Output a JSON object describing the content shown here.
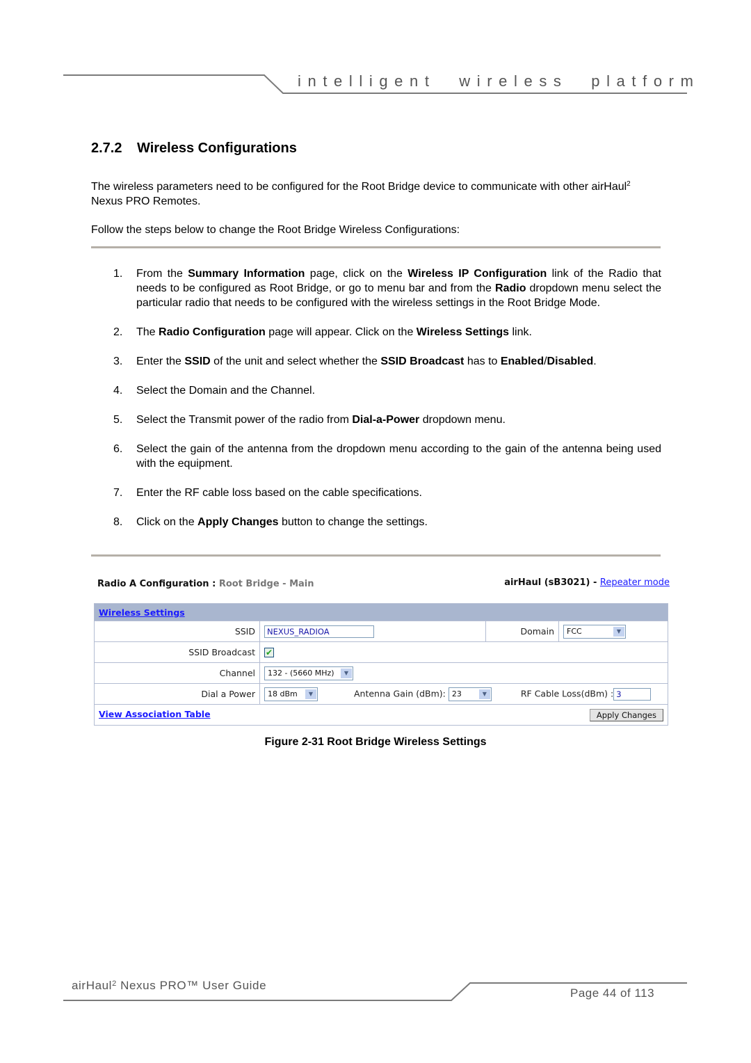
{
  "header": {
    "tagline": "intelligent wireless platform"
  },
  "section": {
    "number": "2.7.2",
    "title": "Wireless Configurations"
  },
  "intro": {
    "line_pre": "The wireless parameters need to be configured for the Root Bridge device to communicate with other airHaul",
    "superscript": "2",
    "line_post": " Nexus PRO Remotes.",
    "follow": "Follow the steps below to change the Root Bridge Wireless Configurations:"
  },
  "steps": [
    {
      "n": "1.",
      "parts": [
        [
          "From the ",
          false
        ],
        [
          "Summary Information",
          true
        ],
        [
          " page, click on the ",
          false
        ],
        [
          "Wireless IP Configuration",
          true
        ],
        [
          " link of the Radio that needs to be configured as Root Bridge, or go to menu bar and from the ",
          false
        ],
        [
          "Radio",
          true
        ],
        [
          " dropdown menu select the particular radio that needs to be configured with the wireless settings in the Root Bridge Mode.",
          false
        ]
      ]
    },
    {
      "n": "2.",
      "parts": [
        [
          "The ",
          false
        ],
        [
          "Radio Configuration",
          true
        ],
        [
          " page will appear. Click on the ",
          false
        ],
        [
          "Wireless Settings",
          true
        ],
        [
          " link.",
          false
        ]
      ]
    },
    {
      "n": "3.",
      "parts": [
        [
          "Enter the ",
          false
        ],
        [
          "SSID",
          true
        ],
        [
          " of the unit and select whether the ",
          false
        ],
        [
          "SSID Broadcast",
          true
        ],
        [
          " has to ",
          false
        ],
        [
          "Enabled",
          true
        ],
        [
          "/",
          false
        ],
        [
          "Disabled",
          true
        ],
        [
          ".",
          false
        ]
      ]
    },
    {
      "n": "4.",
      "parts": [
        [
          "Select the Domain and the Channel.",
          false
        ]
      ]
    },
    {
      "n": "5.",
      "parts": [
        [
          "Select the Transmit power of the radio from ",
          false
        ],
        [
          "Dial-a-Power",
          true
        ],
        [
          " dropdown menu.",
          false
        ]
      ]
    },
    {
      "n": "6.",
      "parts": [
        [
          "Select the gain of the antenna from the dropdown menu according to the gain of the antenna being used with the equipment.",
          false
        ]
      ]
    },
    {
      "n": "7.",
      "parts": [
        [
          "Enter the RF cable loss based on the cable specifications.",
          false
        ]
      ]
    },
    {
      "n": "8.",
      "parts": [
        [
          "Click on the ",
          false
        ],
        [
          "Apply Changes",
          true
        ],
        [
          " button to change the settings.",
          false
        ]
      ]
    }
  ],
  "figure": {
    "title": "Radio A Configuration : ",
    "subtitle": "Root Bridge - Main",
    "device": "airHaul (sB3021) - ",
    "mode_link": "Repeater mode",
    "section_link": "Wireless Settings",
    "ssid_label": "SSID",
    "ssid_value": "NEXUS_RADIOA",
    "domain_label": "Domain",
    "domain_value": "FCC",
    "ssid_broadcast_label": "SSID Broadcast",
    "ssid_broadcast_checked": true,
    "channel_label": "Channel",
    "channel_value": "132 - (5660 MHz)",
    "power_label": "Dial a Power",
    "power_value": "18 dBm",
    "antenna_label": "Antenna Gain (dBm):",
    "antenna_value": "23",
    "cable_label": "RF Cable Loss(dBm) :",
    "cable_value": "3",
    "assoc_link": "View Association Table",
    "apply_button": "Apply Changes",
    "check_glyph": "✔",
    "arrow_glyph": "▼"
  },
  "caption": "Figure 2-31 Root Bridge Wireless Settings",
  "footer": {
    "doc_pre": "airHaul",
    "doc_sup": "2",
    "doc_post": " Nexus PRO™ User Guide",
    "page": "Page 44 of 113"
  }
}
